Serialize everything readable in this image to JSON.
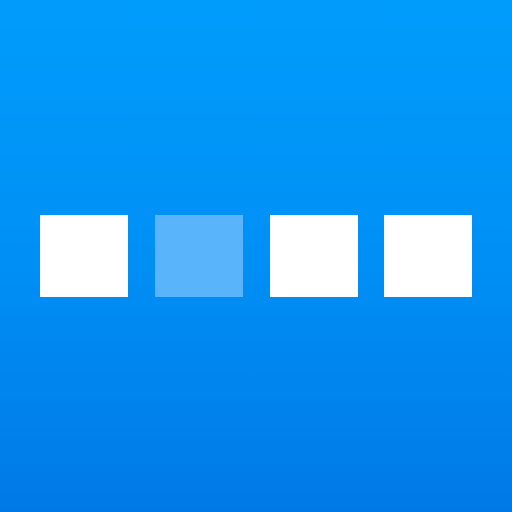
{
  "icon": {
    "name": "four-squares-app-icon",
    "background_colors": [
      "#009cfc",
      "#0090f5",
      "#0079e6"
    ],
    "squares": [
      {
        "state": "filled",
        "color": "#ffffff"
      },
      {
        "state": "dimmed",
        "color": "#5ab4fb"
      },
      {
        "state": "filled",
        "color": "#ffffff"
      },
      {
        "state": "filled",
        "color": "#ffffff"
      }
    ]
  }
}
